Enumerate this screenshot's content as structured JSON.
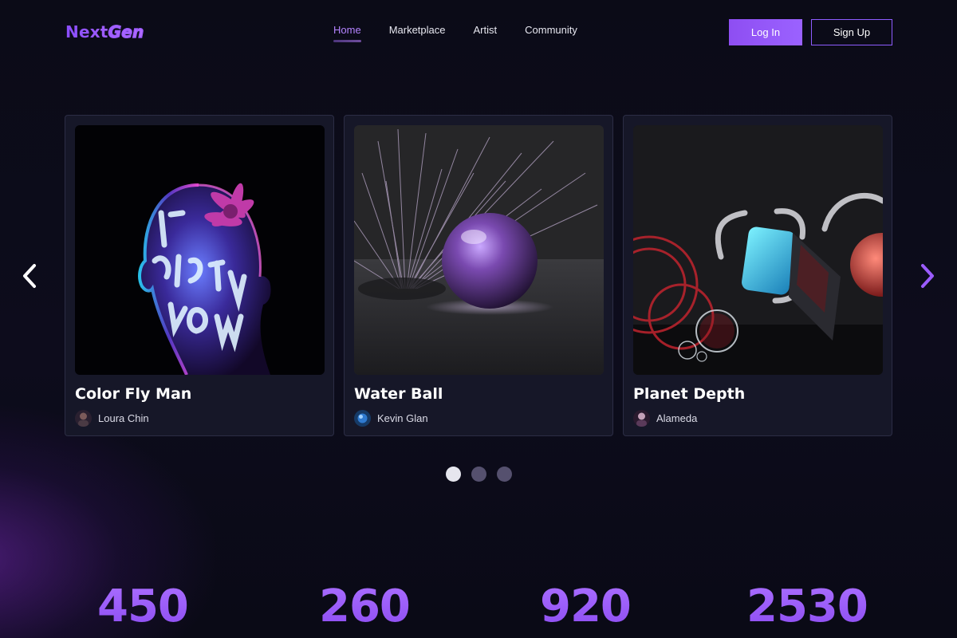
{
  "brand": {
    "logo_solid": "Next",
    "logo_outline": "Gen",
    "accent": "#9b5cff"
  },
  "nav": {
    "items": [
      {
        "label": "Home",
        "active": true
      },
      {
        "label": "Marketplace",
        "active": false
      },
      {
        "label": "Artist",
        "active": false
      },
      {
        "label": "Community",
        "active": false
      }
    ]
  },
  "auth": {
    "login_label": "Log In",
    "signup_label": "Sign Up"
  },
  "carousel": {
    "prev_icon": "chevron-left-icon",
    "next_icon": "chevron-right-icon",
    "cards": [
      {
        "title": "Color Fly Man",
        "artist": "Loura Chin"
      },
      {
        "title": "Water Ball",
        "artist": "Kevin Glan"
      },
      {
        "title": "Planet Depth",
        "artist": "Alameda"
      }
    ],
    "pages": 3,
    "active_page": 1
  },
  "stats": [
    "450",
    "260",
    "920",
    "2530"
  ]
}
